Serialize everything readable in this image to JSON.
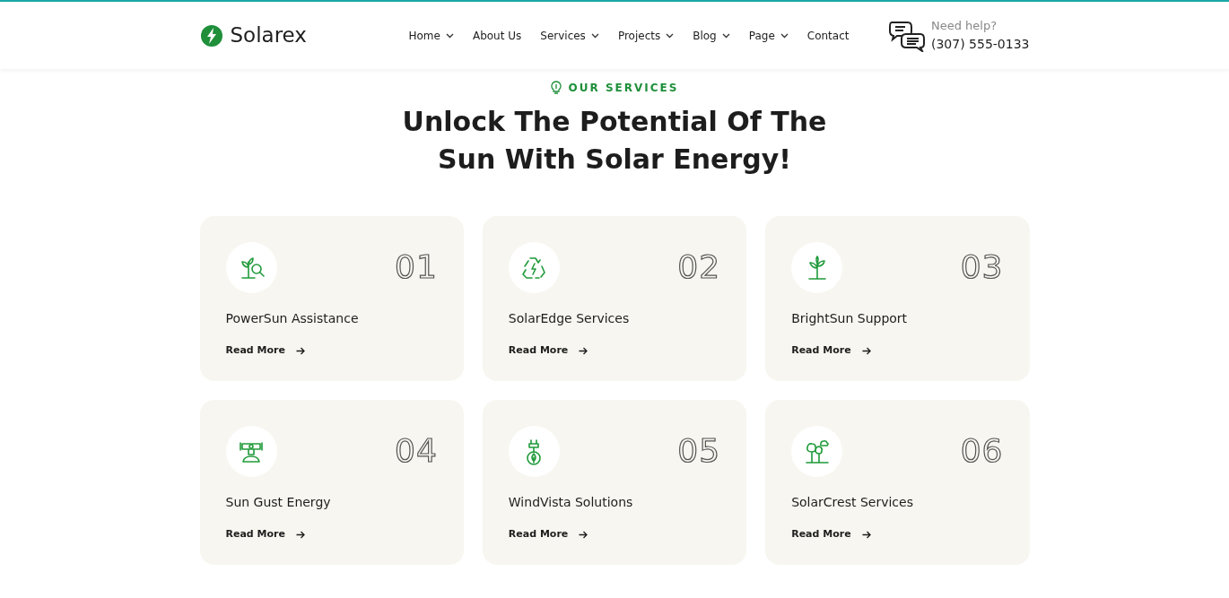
{
  "header": {
    "logo": "Solarex",
    "nav": [
      {
        "label": "Home",
        "has_dropdown": true
      },
      {
        "label": "About Us",
        "has_dropdown": false
      },
      {
        "label": "Services",
        "has_dropdown": true
      },
      {
        "label": "Projects",
        "has_dropdown": true
      },
      {
        "label": "Blog",
        "has_dropdown": true
      },
      {
        "label": "Page",
        "has_dropdown": true
      },
      {
        "label": "Contact",
        "has_dropdown": false
      }
    ],
    "help": {
      "label": "Need help?",
      "phone": "(307) 555-0133"
    }
  },
  "section": {
    "eyebrow": "OUR SERVICES",
    "heading_lines": [
      "Unlock The Potential Of The",
      "Sun With Solar Energy!"
    ]
  },
  "services": [
    {
      "number": "01",
      "title": "PowerSun Assistance",
      "link": "Read More"
    },
    {
      "number": "02",
      "title": "SolarEdge Services",
      "link": "Read More"
    },
    {
      "number": "03",
      "title": "BrightSun Support",
      "link": "Read More"
    },
    {
      "number": "04",
      "title": "Sun Gust Energy",
      "link": "Read More"
    },
    {
      "number": "05",
      "title": "WindVista Solutions",
      "link": "Read More"
    },
    {
      "number": "06",
      "title": "SolarCrest Services",
      "link": "Read More"
    }
  ]
}
